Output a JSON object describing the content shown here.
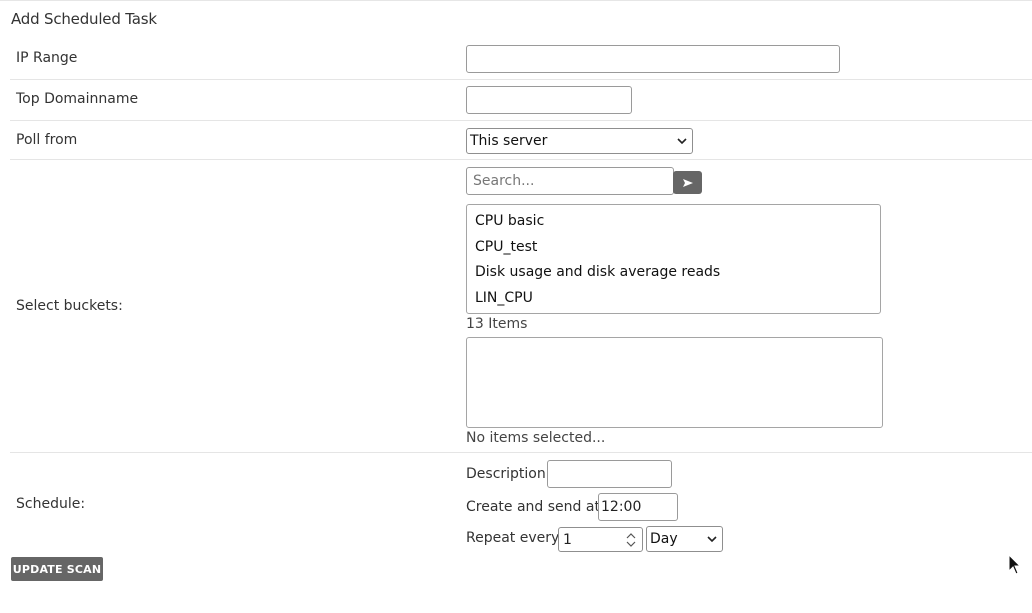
{
  "page": {
    "title": "Add Scheduled Task"
  },
  "form": {
    "ip_range": {
      "label": "IP Range",
      "value": ""
    },
    "top_domain": {
      "label": "Top Domainname",
      "value": ""
    },
    "poll_from": {
      "label": "Poll from",
      "selected": "This server"
    },
    "buckets": {
      "label": "Select buckets:",
      "search_placeholder": "Search...",
      "available_items": [
        "CPU basic",
        "CPU_test",
        "Disk usage and disk average reads",
        "LIN_CPU"
      ],
      "count_text": "13 Items",
      "selected_status": "No items selected..."
    },
    "schedule": {
      "label": "Schedule:",
      "description_label": "Description",
      "description_value": "",
      "create_send_label": "Create and send at",
      "time_value": "12:00",
      "repeat_label": "Repeat every",
      "repeat_value": "1",
      "repeat_unit": "Day"
    }
  },
  "actions": {
    "update_label": "UPDATE SCAN"
  },
  "icons": {
    "search_button": "arrow-right-icon",
    "select": "chevron-down-icon",
    "spinner": "spinner-icon",
    "cursor": "mouse-cursor-icon"
  },
  "colors": {
    "button_bg": "#666666",
    "border": "#9a9a9a",
    "divider": "#e5e5e5"
  }
}
